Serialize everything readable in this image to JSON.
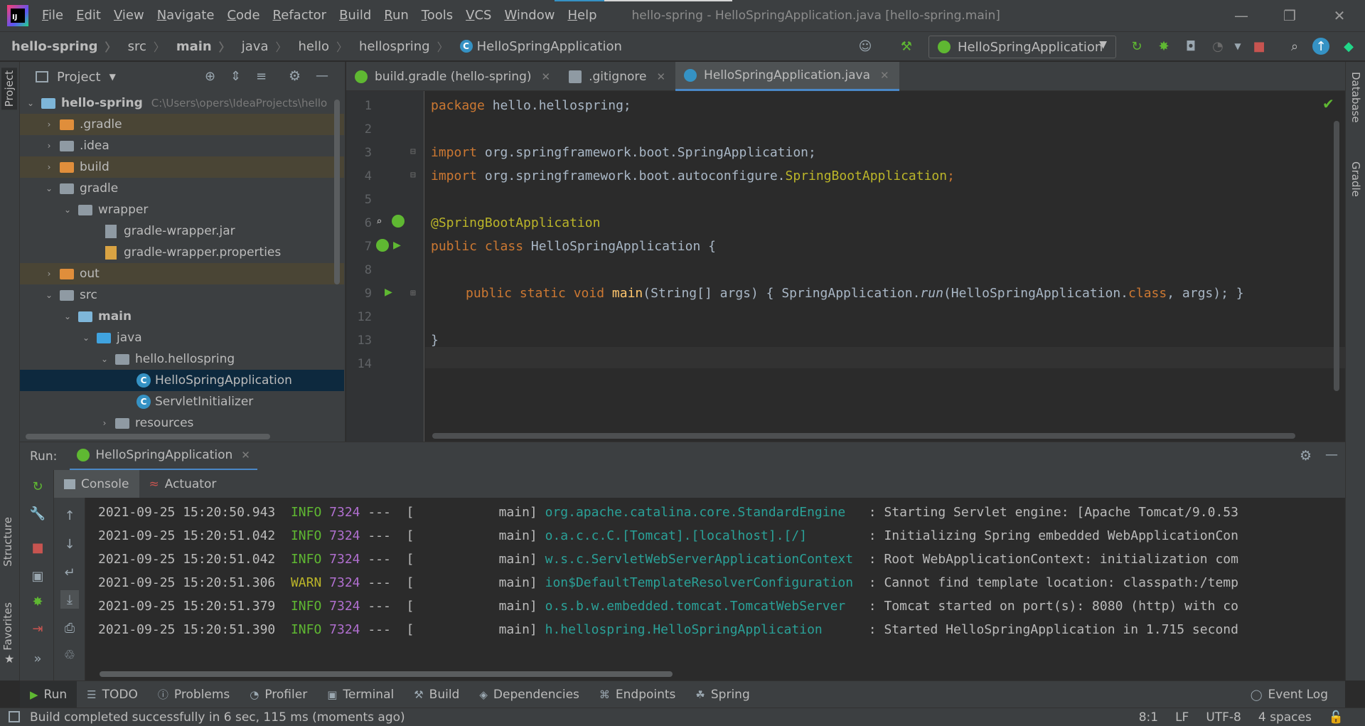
{
  "menubar": {
    "items": [
      "File",
      "Edit",
      "View",
      "Navigate",
      "Code",
      "Refactor",
      "Build",
      "Run",
      "Tools",
      "VCS",
      "Window",
      "Help"
    ],
    "window_title": "hello-spring - HelloSpringApplication.java [hello-spring.main]"
  },
  "navbar": {
    "crumbs": [
      "hello-spring",
      "src",
      "main",
      "java",
      "hello",
      "hellospring",
      "HelloSpringApplication"
    ],
    "run_config": "HelloSpringApplication"
  },
  "left_strip": {
    "project": "Project",
    "structure": "Structure",
    "favorites": "Favorites"
  },
  "right_strip": {
    "database": "Database",
    "gradle": "Gradle"
  },
  "project_panel": {
    "title": "Project",
    "root_name": "hello-spring",
    "root_path": "C:\\Users\\opers\\IdeaProjects\\hello",
    "items": [
      {
        "name": ".gradle"
      },
      {
        "name": ".idea"
      },
      {
        "name": "build"
      },
      {
        "name": "gradle"
      },
      {
        "name": "wrapper"
      },
      {
        "name": "gradle-wrapper.jar"
      },
      {
        "name": "gradle-wrapper.properties"
      },
      {
        "name": "out"
      },
      {
        "name": "src"
      },
      {
        "name": "main"
      },
      {
        "name": "java"
      },
      {
        "name": "hello.hellospring"
      },
      {
        "name": "HelloSpringApplication"
      },
      {
        "name": "ServletInitializer"
      },
      {
        "name": "resources"
      }
    ]
  },
  "editor_tabs": [
    {
      "label": "build.gradle (hello-spring)"
    },
    {
      "label": ".gitignore"
    },
    {
      "label": "HelloSpringApplication.java"
    }
  ],
  "editor": {
    "line_numbers": [
      "1",
      "2",
      "3",
      "4",
      "5",
      "6",
      "7",
      "8",
      "9",
      "12",
      "13",
      "14"
    ],
    "code": {
      "l1_kw": "package",
      "l1_rest": " hello.hellospring;",
      "l3_kw": "import",
      "l3_rest": " org.springframework.boot.SpringApplication;",
      "l4_kw": "import",
      "l4_rest": " org.springframework.boot.autoconfigure.",
      "l4_ann": "SpringBootApplication",
      "l4_end": ";",
      "l6_ann": "@SpringBootApplication",
      "l7_kw": "public class",
      "l7_rest": " HelloSpringApplication {",
      "l9_kw": "public static void",
      "l9_fn": "main",
      "l9_args": "(String[] args) { SpringApplication.",
      "l9_run": "run",
      "l9_call": "(HelloSpringApplication.",
      "l9_class": "class",
      "l9_end": ", args); }",
      "l13": "}"
    }
  },
  "run_panel": {
    "label": "Run:",
    "tab": "HelloSpringApplication",
    "console_tab": "Console",
    "actuator_tab": "Actuator",
    "logs": [
      {
        "ts": "2021-09-25 15:20:50.943",
        "level": "INFO",
        "pid": "7324",
        "thread": "---  [           main]",
        "logger": "org.apache.catalina.core.StandardEngine  ",
        "msg": ": Starting Servlet engine: [Apache Tomcat/9.0.53"
      },
      {
        "ts": "2021-09-25 15:20:51.042",
        "level": "INFO",
        "pid": "7324",
        "thread": "---  [           main]",
        "logger": "o.a.c.c.C.[Tomcat].[localhost].[/]       ",
        "msg": ": Initializing Spring embedded WebApplicationCon"
      },
      {
        "ts": "2021-09-25 15:20:51.042",
        "level": "INFO",
        "pid": "7324",
        "thread": "---  [           main]",
        "logger": "w.s.c.ServletWebServerApplicationContext ",
        "msg": ": Root WebApplicationContext: initialization com"
      },
      {
        "ts": "2021-09-25 15:20:51.306",
        "level": "WARN",
        "pid": "7324",
        "thread": "---  [           main]",
        "logger": "ion$DefaultTemplateResolverConfiguration ",
        "msg": ": Cannot find template location: classpath:/temp"
      },
      {
        "ts": "2021-09-25 15:20:51.379",
        "level": "INFO",
        "pid": "7324",
        "thread": "---  [           main]",
        "logger": "o.s.b.w.embedded.tomcat.TomcatWebServer  ",
        "msg": ": Tomcat started on port(s): 8080 (http) with co"
      },
      {
        "ts": "2021-09-25 15:20:51.390",
        "level": "INFO",
        "pid": "7324",
        "thread": "---  [           main]",
        "logger": "h.hellospring.HelloSpringApplication     ",
        "msg": ": Started HelloSpringApplication in 1.715 second"
      }
    ]
  },
  "bottom_tabs": [
    "Run",
    "TODO",
    "Problems",
    "Profiler",
    "Terminal",
    "Build",
    "Dependencies",
    "Endpoints",
    "Spring"
  ],
  "event_log": "Event Log",
  "statusbar": {
    "message": "Build completed successfully in 6 sec, 115 ms (moments ago)",
    "position": "8:1",
    "line_sep": "LF",
    "encoding": "UTF-8",
    "indent": "4 spaces"
  }
}
